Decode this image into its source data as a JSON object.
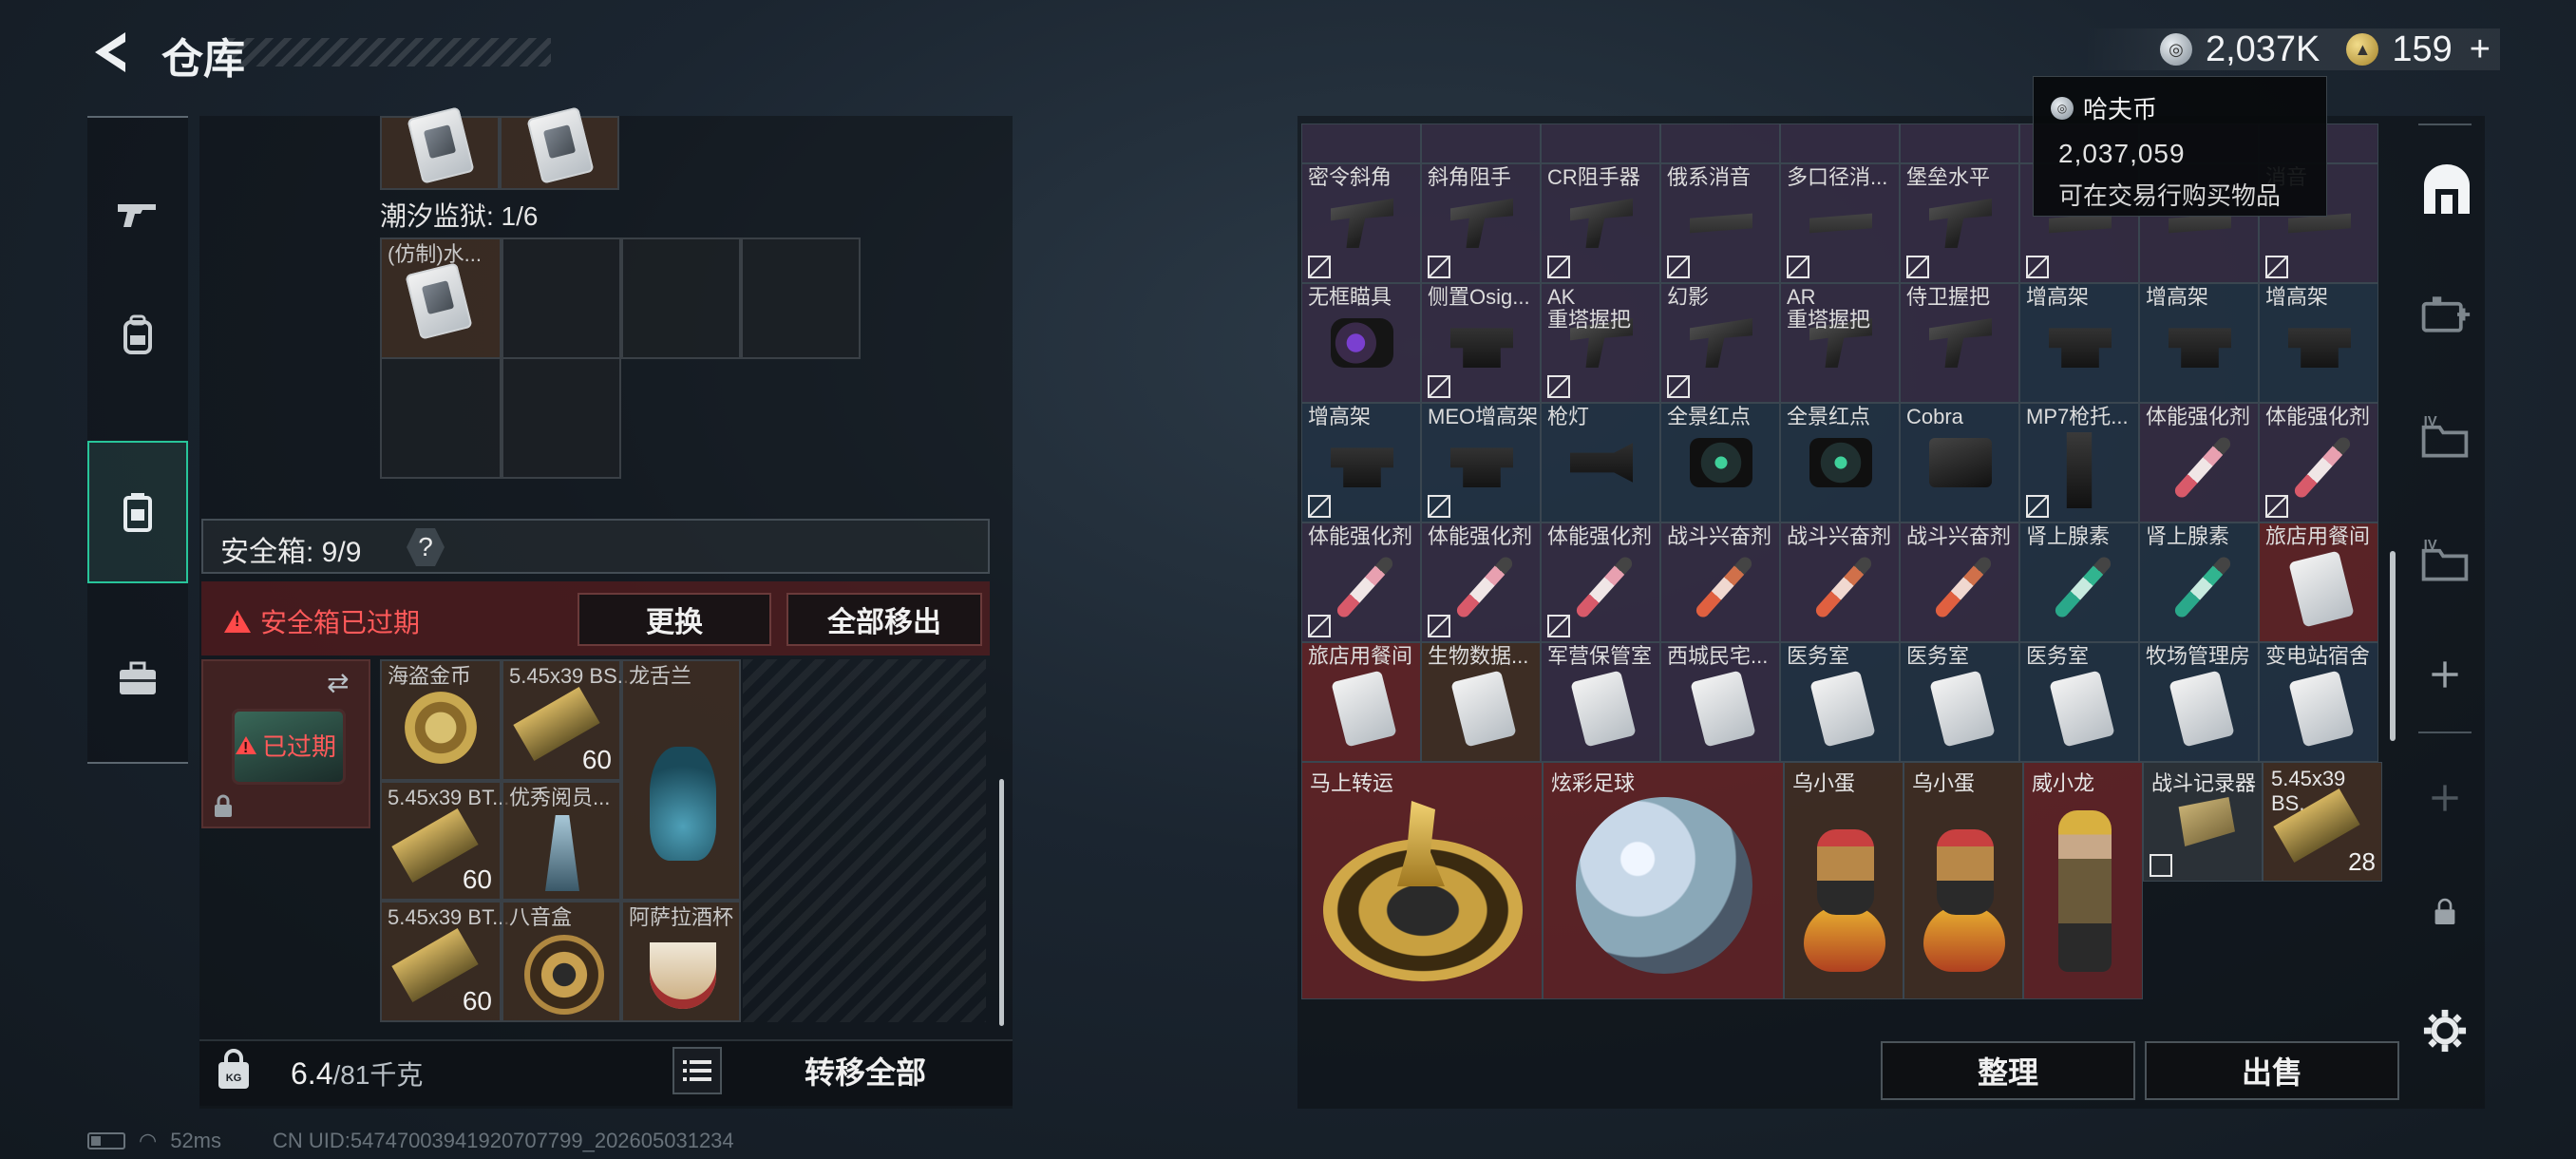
{
  "header": {
    "title": "仓库",
    "currency": [
      {
        "icon": "silver-coin-icon",
        "value": "2,037K"
      },
      {
        "icon": "gold-coin-icon",
        "value": "159"
      }
    ],
    "add_label": "+"
  },
  "tooltip": {
    "title": "哈夫币",
    "value": "2,037,059",
    "description": "可在交易行购买物品"
  },
  "side_nav": [
    {
      "id": "weapon",
      "icon": "gun-icon"
    },
    {
      "id": "equipment",
      "icon": "backpack-icon"
    },
    {
      "id": "container",
      "icon": "container-icon",
      "active": true
    },
    {
      "id": "case",
      "icon": "briefcase-icon"
    }
  ],
  "left_panel": {
    "tide_prison_label": "潮汐监狱: 1/6",
    "tide_item_name": "(仿制)水...",
    "safebox_label": "安全箱: 9/9",
    "safebox_help": "?",
    "expired_text": "安全箱已过期",
    "replace_btn": "更换",
    "move_all_btn": "全部移出",
    "safebox_expired_badge": "已过期",
    "swap_icon": "⇄",
    "items": [
      {
        "name": "海盗金币",
        "count": ""
      },
      {
        "name": "5.45x39 BS...",
        "count": "60"
      },
      {
        "name": "龙舌兰",
        "count": ""
      },
      {
        "name": "5.45x39 BT...",
        "count": "60"
      },
      {
        "name": "优秀阅员...",
        "count": ""
      },
      {
        "name": "5.45x39 BT...",
        "count": "60"
      },
      {
        "name": "八音盒",
        "count": ""
      },
      {
        "name": "阿萨拉酒杯",
        "count": ""
      }
    ],
    "weight_current": "6.4",
    "weight_max": "/81千克",
    "transfer_all_btn": "转移全部"
  },
  "status": {
    "ping": "52ms",
    "uid": "CN UID:5474700394192070779​9_202605031234"
  },
  "stash": {
    "rows": [
      [
        {
          "name": "密令斜角",
          "color": "purple",
          "thumb": "grip",
          "flag": true
        },
        {
          "name": "斜角阻手",
          "color": "purple",
          "thumb": "grip",
          "flag": true
        },
        {
          "name": "CR阻手器",
          "color": "purple",
          "thumb": "grip",
          "flag": true
        },
        {
          "name": "俄系消音",
          "color": "purple",
          "thumb": "supp",
          "flag": true
        },
        {
          "name": "多口径消...",
          "color": "purple",
          "thumb": "supp",
          "flag": true
        },
        {
          "name": "堡垒水平",
          "color": "purple",
          "thumb": "grip",
          "flag": true
        },
        {
          "name": "",
          "color": "purple",
          "thumb": "supp",
          "flag": true
        },
        {
          "name": "",
          "color": "purple",
          "thumb": "supp",
          "flag": false
        },
        {
          "name": "消音",
          "color": "purple",
          "thumb": "supp",
          "flag": true
        }
      ],
      [
        {
          "name": "无框瞄具",
          "color": "purple",
          "thumb": "scope",
          "flag": false
        },
        {
          "name": "侧置Osig...",
          "color": "purple",
          "thumb": "mount",
          "flag": true
        },
        {
          "name": "AK\n重塔握把",
          "color": "purple",
          "thumb": "grip",
          "flag": true
        },
        {
          "name": "幻影",
          "color": "purple",
          "thumb": "grip",
          "flag": true
        },
        {
          "name": "AR\n重塔握把",
          "color": "purple",
          "thumb": "grip",
          "flag": false
        },
        {
          "name": "侍卫握把",
          "color": "purple",
          "thumb": "grip",
          "flag": false
        },
        {
          "name": "增高架",
          "color": "blue",
          "thumb": "mount",
          "flag": false
        },
        {
          "name": "增高架",
          "color": "blue",
          "thumb": "mount",
          "flag": false
        },
        {
          "name": "增高架",
          "color": "blue",
          "thumb": "mount",
          "flag": false
        }
      ],
      [
        {
          "name": "增高架",
          "color": "blue",
          "thumb": "mount",
          "flag": true
        },
        {
          "name": "MEO增高架",
          "color": "blue",
          "thumb": "mount",
          "flag": true
        },
        {
          "name": "枪灯",
          "color": "blue",
          "thumb": "light",
          "flag": false
        },
        {
          "name": "全景红点",
          "color": "blue",
          "thumb": "dot",
          "flag": false
        },
        {
          "name": "全景红点",
          "color": "blue",
          "thumb": "dot",
          "flag": false
        },
        {
          "name": "Cobra",
          "color": "blue",
          "thumb": "cobra",
          "flag": false
        },
        {
          "name": "MP7枪托...",
          "color": "blue",
          "thumb": "mp7",
          "flag": true
        },
        {
          "name": "体能强化剂",
          "color": "purple",
          "thumb": "stim-red",
          "flag": false
        },
        {
          "name": "体能强化剂",
          "color": "purple",
          "thumb": "stim-red",
          "flag": true
        }
      ],
      [
        {
          "name": "体能强化剂",
          "color": "purple",
          "thumb": "stim-red",
          "flag": true
        },
        {
          "name": "体能强化剂",
          "color": "purple",
          "thumb": "stim-red",
          "flag": true
        },
        {
          "name": "体能强化剂",
          "color": "purple",
          "thumb": "stim-red",
          "flag": true
        },
        {
          "name": "战斗兴奋剂",
          "color": "purple",
          "thumb": "stim-orange",
          "flag": false
        },
        {
          "name": "战斗兴奋剂",
          "color": "purple",
          "thumb": "stim-orange",
          "flag": false
        },
        {
          "name": "战斗兴奋剂",
          "color": "purple",
          "thumb": "stim-orange",
          "flag": false
        },
        {
          "name": "肾上腺素",
          "color": "blue",
          "thumb": "stim-teal",
          "flag": false
        },
        {
          "name": "肾上腺素",
          "color": "blue",
          "thumb": "stim-teal",
          "flag": false
        },
        {
          "name": "旅店用餐间",
          "color": "red",
          "thumb": "card",
          "flag": false
        }
      ],
      [
        {
          "name": "旅店用餐间",
          "color": "red",
          "thumb": "card",
          "flag": false
        },
        {
          "name": "生物数据...",
          "color": "brown",
          "thumb": "card",
          "flag": false
        },
        {
          "name": "军营保管室",
          "color": "purple",
          "thumb": "card",
          "flag": false
        },
        {
          "name": "西城民宅...",
          "color": "purple",
          "thumb": "card",
          "flag": false
        },
        {
          "name": "医务室",
          "color": "blue",
          "thumb": "card",
          "flag": false
        },
        {
          "name": "医务室",
          "color": "blue",
          "thumb": "card",
          "flag": false
        },
        {
          "name": "医务室",
          "color": "blue",
          "thumb": "card",
          "flag": false
        },
        {
          "name": "牧场管理房",
          "color": "blue",
          "thumb": "card",
          "flag": false
        },
        {
          "name": "变电站宿舍",
          "color": "blue",
          "thumb": "card",
          "flag": false
        }
      ]
    ],
    "big_items": [
      {
        "name": "马上转运"
      },
      {
        "name": "炫彩足球"
      },
      {
        "name": "乌小蛋"
      },
      {
        "name": "乌小蛋"
      },
      {
        "name": "威小龙"
      },
      {
        "name": "战斗记录器"
      },
      {
        "name": "5.45x39 BS...",
        "count": "28"
      }
    ],
    "sort_btn": "整理",
    "sell_btn": "出售"
  },
  "right_nav": [
    {
      "icon": "stash-icon"
    },
    {
      "icon": "medkit-add-icon"
    },
    {
      "icon": "folder-iv-icon"
    },
    {
      "icon": "folder-iv-2-icon"
    },
    {
      "icon": "add-icon"
    },
    {
      "icon": "add-disabled-icon"
    },
    {
      "icon": "lock-icon"
    },
    {
      "icon": "settings-gear-icon"
    }
  ]
}
